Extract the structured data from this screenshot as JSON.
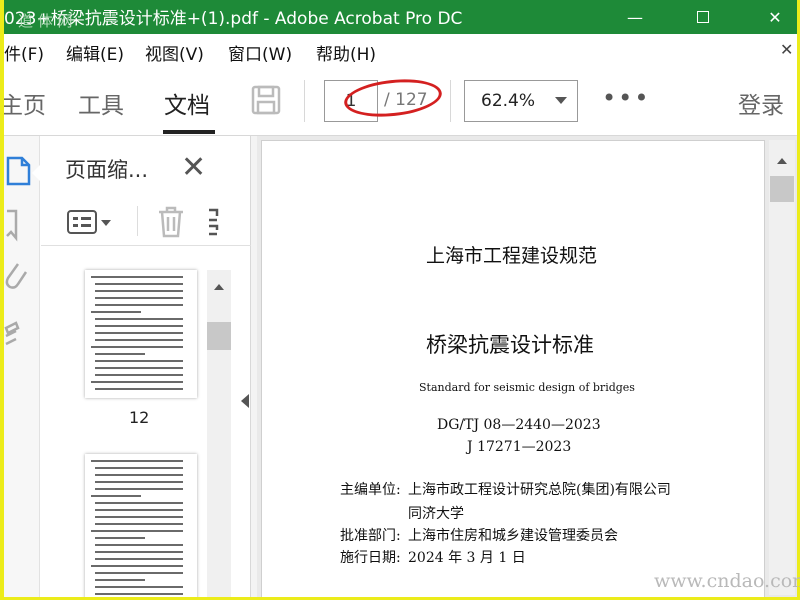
{
  "window": {
    "title": "023+桥梁抗震设计标准+(1).pdf - Adobe Acrobat Pro DC",
    "watermark_top": "道 体 网",
    "minimize": "—",
    "close": "✕"
  },
  "menu": {
    "items": [
      "件(F)",
      "编辑(E)",
      "视图(V)",
      "窗口(W)",
      "帮助(H)"
    ],
    "close": "✕"
  },
  "toolbar": {
    "tabs": [
      "主页",
      "工具",
      "文档"
    ],
    "active_tab": "文档",
    "current_page": "1",
    "page_total": "/ 127",
    "zoom": "62.4%",
    "more": "•••",
    "login": "登录"
  },
  "thumbnails": {
    "panel_title": "页面缩...",
    "close": "✕",
    "page_label": "12"
  },
  "document": {
    "series": "上海市工程建设规范",
    "title": "桥梁抗震设计标准",
    "english": "Standard for seismic design of bridges",
    "code1": "DG/TJ 08—2440—2023",
    "code2": "J 17271—2023",
    "editor_label": "主编单位:",
    "editor1": "上海市政工程设计研究总院(集团)有限公司",
    "editor2": "同济大学",
    "approver_label": "批准部门:",
    "approver": "上海市住房和城乡建设管理委员会",
    "date_label": "施行日期:",
    "date": "2024 年 3 月 1 日"
  },
  "watermark_bottom": "www.cndao.com",
  "colors": {
    "titlebar": "#1e8a38",
    "border": "#ecec1a",
    "active_icon": "#2f7fd8",
    "annotation": "#d42020"
  }
}
